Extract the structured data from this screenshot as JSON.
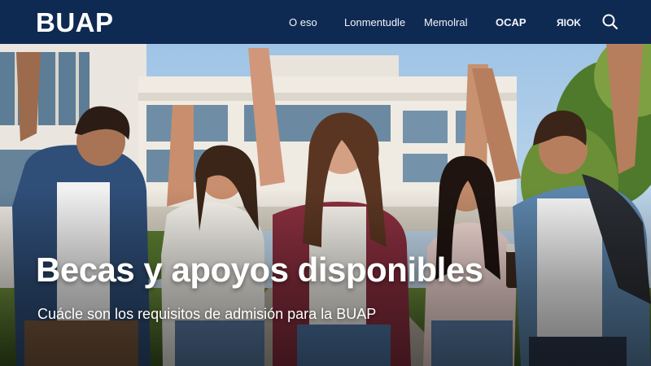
{
  "header": {
    "logo": "BUAP",
    "nav": [
      {
        "label": "O eso"
      },
      {
        "label": "Lonmentudle"
      },
      {
        "label": "Memolral"
      },
      {
        "label": "OCAP"
      },
      {
        "label": "ЯIOK"
      }
    ],
    "search_icon": "search-icon"
  },
  "hero": {
    "title": "Becas y apoyos disponibles",
    "subtitle": "Cuácle son los requisitos de admisión para la BUAP",
    "image": "students-celebrating-campus-photo"
  },
  "colors": {
    "header_bg": "#0f2a52",
    "header_text": "#ffffff",
    "hero_text": "#ffffff"
  }
}
